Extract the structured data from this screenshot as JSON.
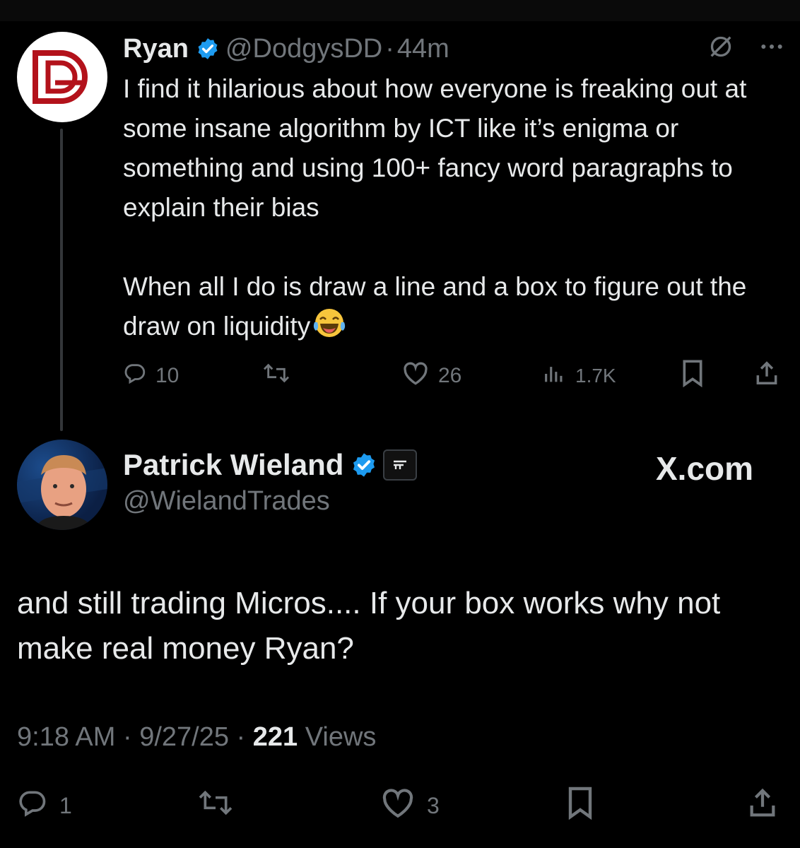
{
  "original_tweet": {
    "author_name": "Ryan",
    "handle": "@DodgysDD",
    "separator": "·",
    "time_ago": "44m",
    "paragraph1": "I find it hilarious about how everyone is freaking out at some insane algorithm by ICT like it’s enigma or something and using 100+ fancy word paragraphs to explain their bias",
    "paragraph2": "When all I do is draw a line and a box to figure out the draw on liquidity",
    "emoji": "face-with-tears-of-joy",
    "actions": {
      "replies": "10",
      "reposts": "",
      "likes": "26",
      "views": "1.7K"
    },
    "icons": [
      "grok-icon",
      "more-icon",
      "reply-icon",
      "repost-icon",
      "like-icon",
      "views-icon",
      "bookmark-icon",
      "share-icon"
    ]
  },
  "reply_tweet": {
    "author_name": "Patrick Wieland",
    "handle": "@WielandTrades",
    "watermark": "X.com",
    "text": "and still trading Micros.... If your box works why not make real money Ryan?",
    "timestamp": "9:18 AM · 9/27/25 · ",
    "views_count": "221",
    "views_label": " Views",
    "actions": {
      "replies": "1",
      "reposts": "",
      "likes": "3"
    }
  },
  "colors": {
    "background": "#000000",
    "text_primary": "#e7e9ea",
    "text_muted": "#71767b",
    "verified_blue": "#1d9bf0",
    "logo_red": "#b3121b"
  }
}
